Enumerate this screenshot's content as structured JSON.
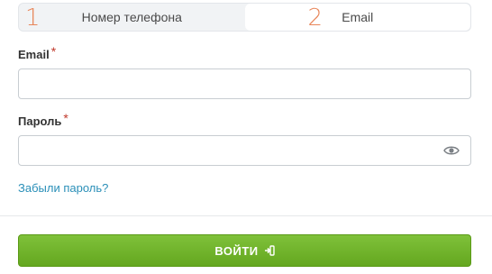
{
  "tabs": [
    {
      "num": "1",
      "label": "Номер телефона"
    },
    {
      "num": "2",
      "label": "Email"
    }
  ],
  "email": {
    "label": "Email",
    "required_mark": "*",
    "value": ""
  },
  "password": {
    "label": "Пароль",
    "required_mark": "*",
    "value": "",
    "toggle_icon": "eye-icon"
  },
  "forgot_link": "Забыли пароль?",
  "submit": {
    "label": "ВОЙТИ",
    "icon": "sign-in-icon"
  },
  "colors": {
    "accent_number": "#e8865a",
    "link": "#2a8fb8",
    "button": "#6eb22a",
    "required": "#c0392b"
  }
}
